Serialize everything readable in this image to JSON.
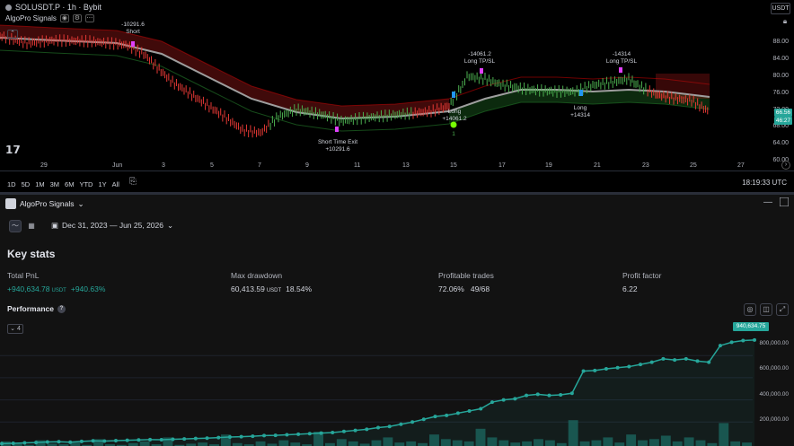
{
  "header": {
    "symbol": "SOLUSDT.P · 1h · Bybit",
    "indicator": "AlgoPro Signals",
    "currency": "USDT"
  },
  "price_axis": [
    "88.00",
    "84.00",
    "80.00",
    "76.00",
    "72.00",
    "68.00",
    "64.00",
    "60.00",
    "56.00"
  ],
  "price_tags": [
    {
      "label": "66.56",
      "color": "#26a69a"
    },
    {
      "label": "46:27",
      "color": "#26a69a"
    }
  ],
  "date_axis": [
    "29",
    "Jun",
    "3",
    "5",
    "7",
    "9",
    "11",
    "13",
    "15",
    "17",
    "19",
    "21",
    "23",
    "25",
    "27"
  ],
  "annotations": {
    "short_value": "-10291.6",
    "short_label": "Short",
    "exit_label": "Short Time Exit",
    "exit_value": "+10291.6",
    "long1_value": "-14061.2",
    "long1_label": "Long TP/SL",
    "long1_entry": "Long",
    "long1_entry_value": "+14061.2",
    "long1_marker": "1",
    "long2_value": "-14314",
    "long2_label": "Long TP/SL",
    "long2_entry": "Long",
    "long2_entry_value": "+14314"
  },
  "toolbar": {
    "timeframes": [
      "1D",
      "5D",
      "1M",
      "3M",
      "6M",
      "YTD",
      "1Y",
      "All"
    ],
    "clock": "18:19:33 UTC"
  },
  "panel": {
    "title": "AlgoPro Signals",
    "date_range": "Dec 31, 2023 — Jun 25, 2026",
    "key_stats": "Key stats",
    "stats": [
      {
        "label": "Total PnL",
        "value": "+940,634.78",
        "unit": "USDT",
        "pct": "+940.63%"
      },
      {
        "label": "Max drawdown",
        "value": "60,413.59",
        "unit": "USDT",
        "pct": "18.54%"
      },
      {
        "label": "Profitable trades",
        "value": "72.06%",
        "unit": "",
        "pct": "49/68"
      },
      {
        "label": "Profit factor",
        "value": "6.22",
        "unit": "",
        "pct": ""
      }
    ],
    "performance": "Performance",
    "zoom": "4",
    "last_value": "940,634.75",
    "y_axis": [
      "800,000.00",
      "600,000.00",
      "400,000.00",
      "200,000.00"
    ]
  },
  "chart_data": {
    "type": "line",
    "title": "Performance",
    "xlabel": "",
    "ylabel": "",
    "ylim": [
      0,
      1000000
    ],
    "series": [
      {
        "values": [
          5000,
          8000,
          12000,
          15000,
          20000,
          22000,
          18000,
          25000,
          30000,
          28000,
          32000,
          35000,
          38000,
          42000,
          40000,
          45000,
          48000,
          52000,
          55000,
          60000,
          65000,
          68000,
          72000,
          78000,
          80000,
          85000,
          90000,
          95000,
          100000,
          105000,
          115000,
          125000,
          135000,
          150000,
          160000,
          180000,
          200000,
          225000,
          250000,
          260000,
          280000,
          300000,
          320000,
          380000,
          400000,
          410000,
          440000,
          450000,
          440000,
          445000,
          460000,
          660000,
          665000,
          680000,
          690000,
          700000,
          720000,
          740000,
          770000,
          760000,
          770000,
          750000,
          740000,
          890000,
          920000,
          935000,
          940635
        ]
      }
    ],
    "bars": [
      8000,
      5000,
      2000,
      10000,
      4000,
      3000,
      6000,
      2000,
      12000,
      3000,
      2000,
      5000,
      8000,
      3000,
      15000,
      2000,
      4000,
      6000,
      3000,
      20000,
      5000,
      3000,
      8000,
      4000,
      10000,
      6000,
      3000,
      25000,
      5000,
      12000,
      8000,
      4000,
      10000,
      15000,
      6000,
      8000,
      5000,
      20000,
      12000,
      10000,
      8000,
      30000,
      15000,
      10000,
      6000,
      8000,
      12000,
      10000,
      5000,
      45000,
      8000,
      10000,
      15000,
      6000,
      20000,
      10000,
      12000,
      18000,
      8000,
      15000,
      10000,
      5000,
      40000,
      8000,
      6000
    ]
  }
}
